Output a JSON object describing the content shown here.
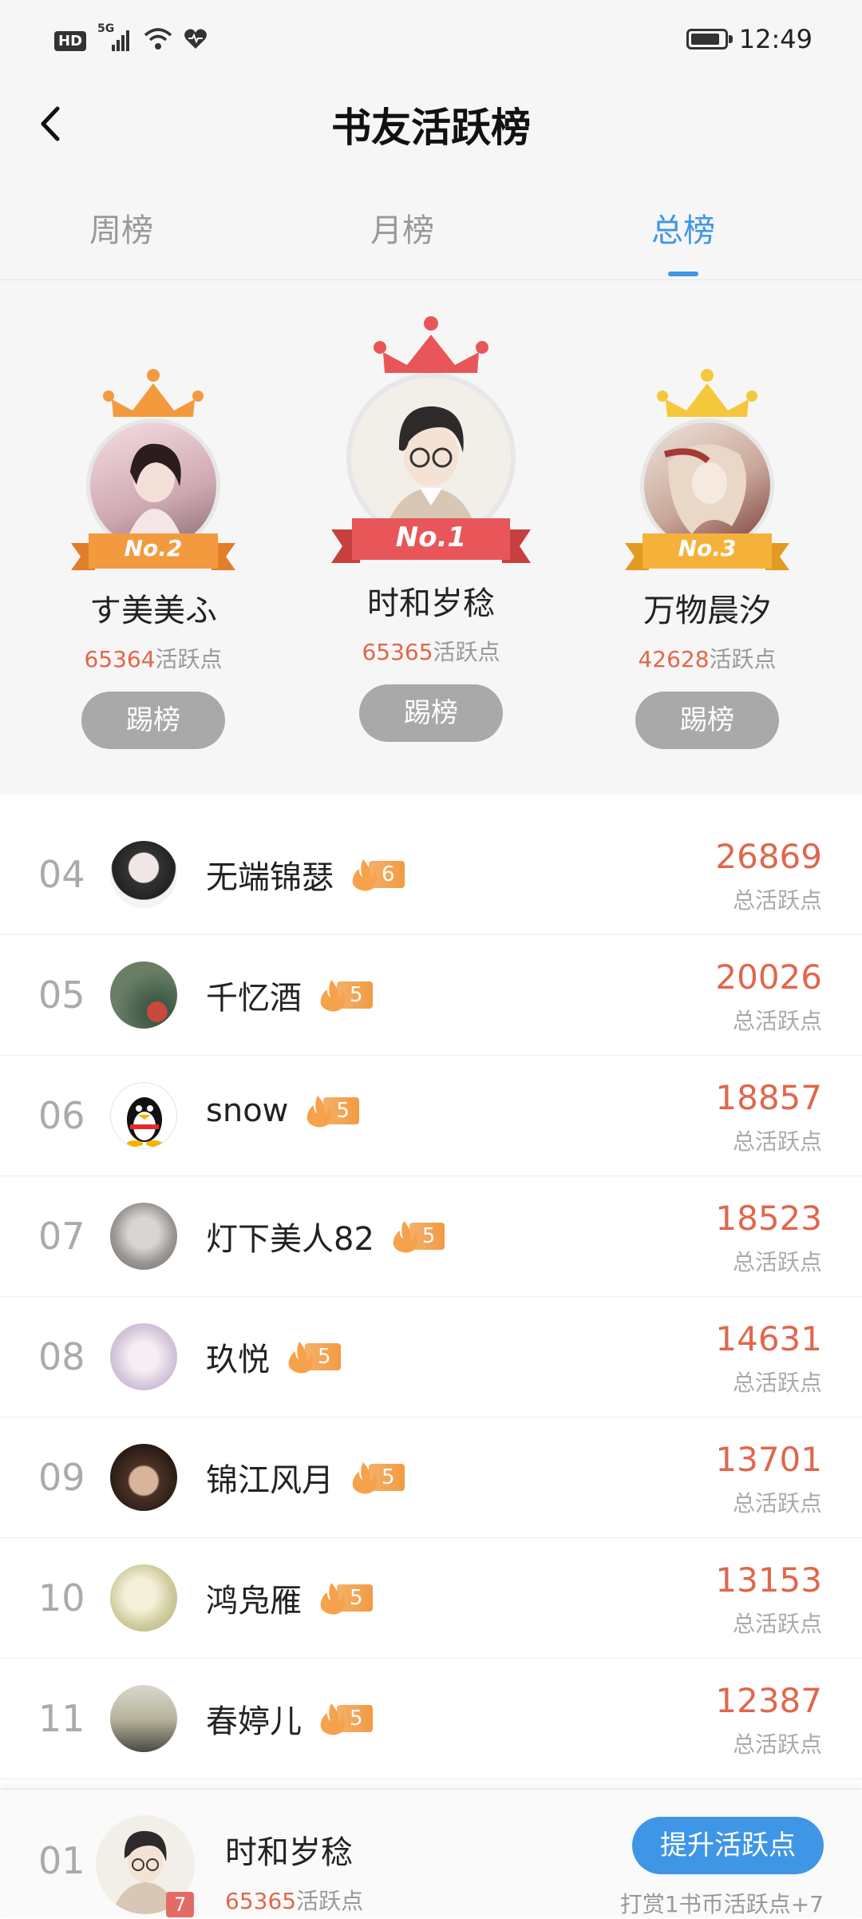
{
  "status_bar": {
    "network": "HD",
    "signal_label": "5G",
    "time": "12:49",
    "icons": [
      "hd-icon",
      "signal-icon",
      "wifi-icon",
      "health-icon",
      "battery-icon"
    ]
  },
  "nav": {
    "title": "书友活跃榜",
    "back_icon": "chevron-left-icon"
  },
  "tabs": [
    {
      "label": "周榜",
      "active": false
    },
    {
      "label": "月榜",
      "active": false
    },
    {
      "label": "总榜",
      "active": true
    }
  ],
  "podium": [
    {
      "rank_label": "No.2",
      "name": "す美美ふ",
      "points": "65364",
      "points_suffix": "活跃点",
      "button": "踢榜",
      "crown_color": "#f39a3e",
      "ribbon_color": "#f39a3e"
    },
    {
      "rank_label": "No.1",
      "name": "时和岁稔",
      "points": "65365",
      "points_suffix": "活跃点",
      "button": "踢榜",
      "crown_color": "#e8565a",
      "ribbon_color": "#e8565a"
    },
    {
      "rank_label": "No.3",
      "name": "万物晨汐",
      "points": "42628",
      "points_suffix": "活跃点",
      "button": "踢榜",
      "crown_color": "#f5c73a",
      "ribbon_color": "#f5b23a"
    }
  ],
  "list": [
    {
      "rank": "04",
      "name": "无端锦瑟",
      "level": "6",
      "score": "26869",
      "score_label": "总活跃点",
      "avatar_color": "#3a3a3a"
    },
    {
      "rank": "05",
      "name": "千忆酒",
      "level": "5",
      "score": "20026",
      "score_label": "总活跃点",
      "avatar_color": "#5f7060"
    },
    {
      "rank": "06",
      "name": "snow",
      "level": "5",
      "score": "18857",
      "score_label": "总活跃点",
      "avatar_color": "#f4f4f4"
    },
    {
      "rank": "07",
      "name": "灯下美人82",
      "level": "5",
      "score": "18523",
      "score_label": "总活跃点",
      "avatar_color": "#a9a9a9"
    },
    {
      "rank": "08",
      "name": "玖悦",
      "level": "5",
      "score": "14631",
      "score_label": "总活跃点",
      "avatar_color": "#dcd6e6"
    },
    {
      "rank": "09",
      "name": "锦江风月",
      "level": "5",
      "score": "13701",
      "score_label": "总活跃点",
      "avatar_color": "#6a4a36"
    },
    {
      "rank": "10",
      "name": "鸿凫雁",
      "level": "5",
      "score": "13153",
      "score_label": "总活跃点",
      "avatar_color": "#d8d4a6"
    },
    {
      "rank": "11",
      "name": "春婷儿",
      "level": "5",
      "score": "12387",
      "score_label": "总活跃点",
      "avatar_color": "#8a8a7a"
    }
  ],
  "me": {
    "rank": "01",
    "level": "7",
    "name": "时和岁稔",
    "points": "65365",
    "points_suffix": "活跃点",
    "boost_button": "提升活跃点",
    "hint": "打赏1书币活跃点+7"
  },
  "colors": {
    "accent": "#3f96e6",
    "score": "#e0674c",
    "badge": "#f29a43"
  }
}
